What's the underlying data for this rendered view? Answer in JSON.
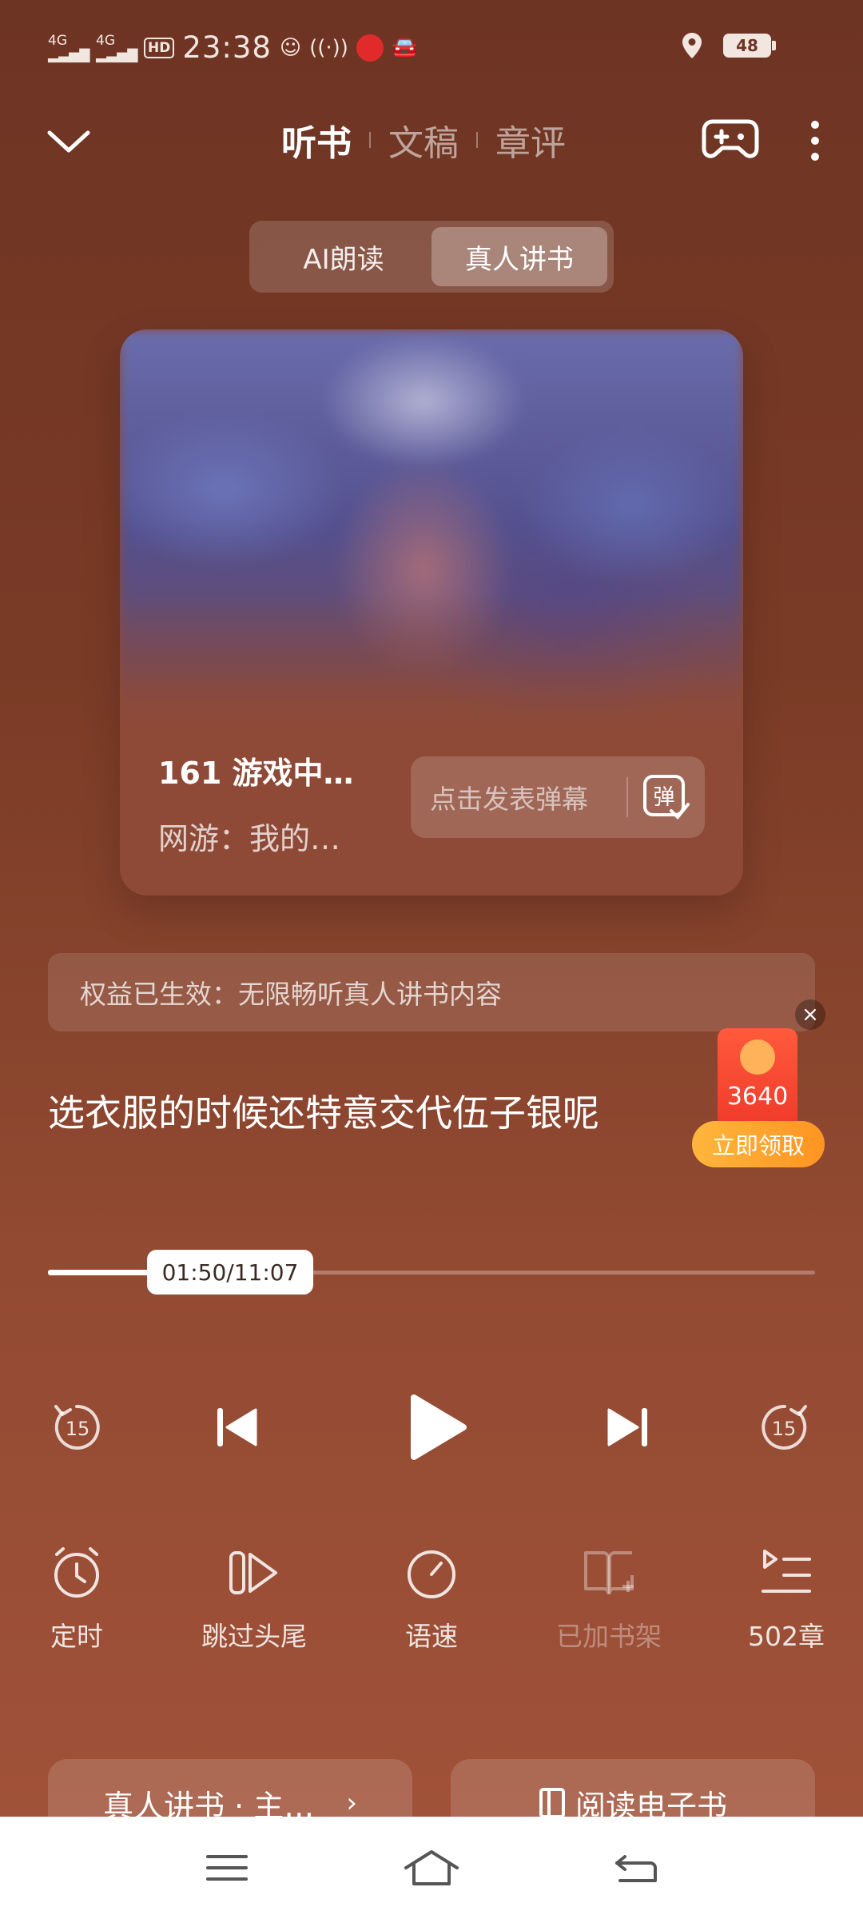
{
  "status_bar": {
    "signal1": "4G",
    "signal2": "4G",
    "hd": "HD",
    "time": "23:38",
    "battery": "48"
  },
  "header": {
    "tabs": [
      {
        "label": "听书",
        "active": true
      },
      {
        "label": "文稿",
        "active": false
      },
      {
        "label": "章评",
        "active": false
      }
    ]
  },
  "mode_switch": {
    "options": [
      {
        "label": "AI朗读",
        "active": false
      },
      {
        "label": "真人讲书",
        "active": true
      }
    ]
  },
  "player_card": {
    "chapter_title": "161 游戏中…",
    "book_title": "网游：我的…",
    "danmaku_placeholder": "点击发表弹幕",
    "danmaku_icon_label": "弹"
  },
  "benefit_text": "权益已生效：无限畅听真人讲书内容",
  "subtitle": "选衣服的时候还特意交代伍子银呢",
  "red_packet": {
    "amount": "3640",
    "button": "立即领取"
  },
  "progress": {
    "time_label": "01:50/11:07",
    "fraction": 0.165
  },
  "controls": {
    "rewind_seconds": "15",
    "forward_seconds": "15"
  },
  "functions": [
    {
      "label": "定时",
      "icon": "alarm-clock-icon",
      "enabled": true
    },
    {
      "label": "跳过头尾",
      "icon": "skip-intro-icon",
      "enabled": true
    },
    {
      "label": "语速",
      "icon": "speed-gauge-icon",
      "enabled": true
    },
    {
      "label": "已加书架",
      "icon": "bookshelf-added-icon",
      "enabled": false
    },
    {
      "label": "502章",
      "icon": "chapter-list-icon",
      "enabled": true
    }
  ],
  "bottom_buttons": {
    "left": "真人讲书 · 主…",
    "right": "阅读电子书"
  },
  "colors": {
    "background_top": "#6e3423",
    "background_bottom": "#a3533a",
    "red_packet": "#f03a2a",
    "claim_button": "#ff9422"
  }
}
